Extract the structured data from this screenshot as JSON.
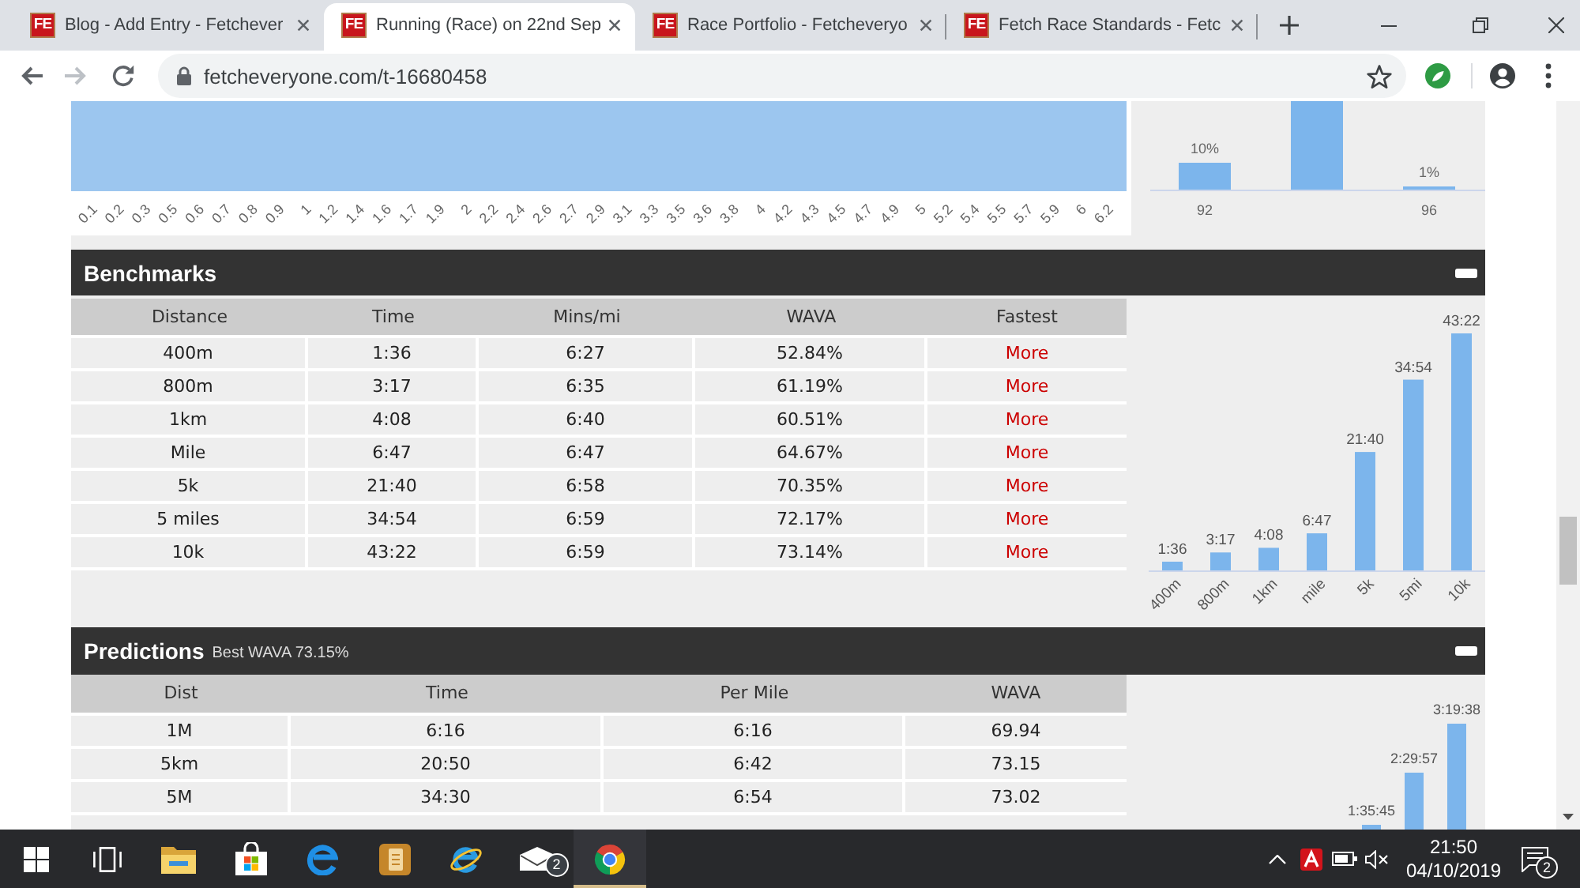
{
  "browser": {
    "tabs": [
      {
        "favicon": "FE",
        "title": "Blog - Add Entry - Fetchever",
        "selected": false
      },
      {
        "favicon": "FE",
        "title": "Running (Race) on 22nd Sep",
        "selected": true
      },
      {
        "favicon": "FE",
        "title": "Race Portfolio - Fetcheveryo",
        "selected": false
      },
      {
        "favicon": "FE",
        "title": "Fetch Race Standards - Fetc",
        "selected": false
      }
    ],
    "forward_disabled": true,
    "url": "fetcheveryone.com/t-16680458"
  },
  "distance_chart": {
    "x_labels": [
      "0.1",
      "0.2",
      "0.3",
      "0.5",
      "0.6",
      "0.7",
      "0.8",
      "0.9",
      "1",
      "1.2",
      "1.4",
      "1.6",
      "1.7",
      "1.9",
      "2",
      "2.2",
      "2.4",
      "2.6",
      "2.7",
      "2.9",
      "3.1",
      "3.3",
      "3.5",
      "3.6",
      "3.8",
      "4",
      "4.2",
      "4.3",
      "4.5",
      "4.7",
      "4.9",
      "5",
      "5.2",
      "5.4",
      "5.5",
      "5.7",
      "5.9",
      "6",
      "6.2"
    ]
  },
  "grade_chart": {
    "bars": [
      {
        "value_label": "10%",
        "axis_label": "92",
        "clipped": false
      },
      {
        "clipped": true
      },
      {
        "value_label": "1%",
        "axis_label": "96",
        "clipped": false
      }
    ]
  },
  "benchmarks": {
    "title": "Benchmarks",
    "columns": [
      {
        "label": "Distance",
        "kind": "text"
      },
      {
        "label": "Time",
        "kind": "text"
      },
      {
        "label": "Mins/mi",
        "kind": "text"
      },
      {
        "label": "WAVA",
        "kind": "text"
      },
      {
        "label": "Fastest",
        "kind": "link"
      }
    ],
    "rows": [
      [
        "400m",
        "1:36",
        "6:27",
        "52.84%",
        "More"
      ],
      [
        "800m",
        "3:17",
        "6:35",
        "61.19%",
        "More"
      ],
      [
        "1km",
        "4:08",
        "6:40",
        "60.51%",
        "More"
      ],
      [
        "Mile",
        "6:47",
        "6:47",
        "64.67%",
        "More"
      ],
      [
        "5k",
        "21:40",
        "6:58",
        "70.35%",
        "More"
      ],
      [
        "5 miles",
        "34:54",
        "6:59",
        "72.17%",
        "More"
      ],
      [
        "10k",
        "43:22",
        "6:59",
        "73.14%",
        "More"
      ]
    ],
    "chart_data": {
      "type": "bar",
      "categories": [
        "400m",
        "800m",
        "1km",
        "mile",
        "5k",
        "5mi",
        "10k"
      ],
      "values": [
        96,
        197,
        248,
        407,
        1300,
        2094,
        2602
      ],
      "value_labels": [
        "1:36",
        "3:17",
        "4:08",
        "6:47",
        "21:40",
        "34:54",
        "43:22"
      ]
    }
  },
  "predictions": {
    "title": "Predictions",
    "subtitle": "Best WAVA 73.15%",
    "columns": [
      {
        "label": "Dist",
        "kind": "text"
      },
      {
        "label": "Time",
        "kind": "text"
      },
      {
        "label": "Per Mile",
        "kind": "text"
      },
      {
        "label": "WAVA",
        "kind": "text"
      }
    ],
    "rows": [
      [
        "1M",
        "6:16",
        "6:16",
        "69.94"
      ],
      [
        "5km",
        "20:50",
        "6:42",
        "73.15"
      ],
      [
        "5M",
        "34:30",
        "6:54",
        "73.02"
      ]
    ],
    "chart": {
      "bars": [
        {
          "value_label": "1:35:45"
        },
        {
          "value_label": "2:29:57"
        },
        {
          "value_label": "3:19:38"
        }
      ]
    }
  },
  "taskbar": {
    "apps": [
      {
        "kind": "start",
        "selected": false
      },
      {
        "kind": "taskview",
        "selected": false
      },
      {
        "kind": "files",
        "selected": false
      },
      {
        "kind": "store",
        "selected": false
      },
      {
        "kind": "edge",
        "selected": false
      },
      {
        "kind": "notes",
        "selected": false
      },
      {
        "kind": "ie",
        "selected": false
      },
      {
        "kind": "mail",
        "selected": false,
        "badge": "2"
      },
      {
        "kind": "chrome",
        "selected": true
      }
    ],
    "time": "21:50",
    "date": "04/10/2019",
    "notification_badge": "2"
  }
}
